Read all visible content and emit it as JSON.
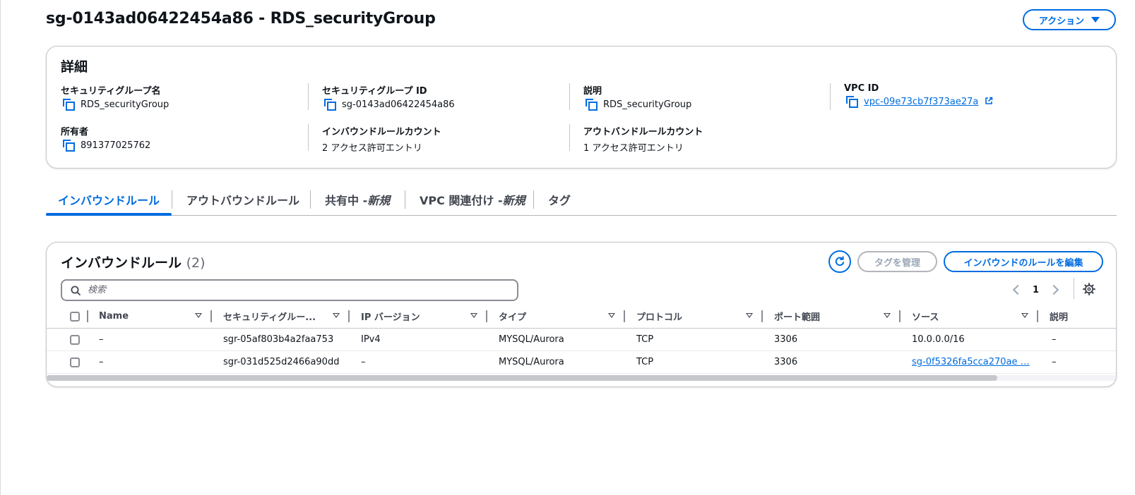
{
  "header": {
    "title": "sg-0143ad06422454a86 - RDS_securityGroup",
    "actions_label": "アクション"
  },
  "details": {
    "heading": "詳細",
    "fields": {
      "name": {
        "label": "セキュリティグループ名",
        "value": "RDS_securityGroup"
      },
      "id": {
        "label": "セキュリティグループ ID",
        "value": "sg-0143ad06422454a86"
      },
      "description": {
        "label": "説明",
        "value": "RDS_securityGroup"
      },
      "vpc": {
        "label": "VPC ID",
        "value": "vpc-09e73cb7f373ae27a"
      },
      "owner": {
        "label": "所有者",
        "value": "891377025762"
      },
      "inbound_count": {
        "label": "インバウンドルールカウント",
        "value": "2 アクセス許可エントリ"
      },
      "outbound_count": {
        "label": "アウトバンドルールカウント",
        "value": "1 アクセス許可エントリ"
      }
    }
  },
  "tabs": [
    {
      "label": "インバウンドルール",
      "suffix": "",
      "active": true
    },
    {
      "label": "アウトバウンドルール",
      "suffix": "",
      "active": false
    },
    {
      "label": "共有中 - ",
      "suffix": "新規",
      "active": false
    },
    {
      "label": "VPC 関連付け - ",
      "suffix": "新規",
      "active": false
    },
    {
      "label": "タグ",
      "suffix": "",
      "active": false
    }
  ],
  "inbound": {
    "heading": "インバウンドルール",
    "count": "(2)",
    "manage_tags_label": "タグを管理",
    "edit_label": "インバウンドのルールを編集",
    "search_placeholder": "検索",
    "page": "1",
    "columns": [
      "Name",
      "セキュリティグルー...",
      "IP バージョン",
      "タイプ",
      "プロトコル",
      "ポート範囲",
      "ソース",
      "説明"
    ],
    "rows": [
      {
        "name": "–",
        "rule_id": "sgr-05af803b4a2faa753",
        "ip_version": "IPv4",
        "type": "MYSQL/Aurora",
        "protocol": "TCP",
        "port": "3306",
        "source": "10.0.0.0/16",
        "description": "–"
      },
      {
        "name": "–",
        "rule_id": "sgr-031d525d2466a90dd",
        "ip_version": "–",
        "type": "MYSQL/Aurora",
        "protocol": "TCP",
        "port": "3306",
        "source": "sg-0f5326fa5cca270ae …",
        "description": "–"
      }
    ]
  },
  "colors": {
    "accent": "#006ce0",
    "text": "#0f141a",
    "border": "#c6c6cd",
    "disabled": "#9ba7b6"
  }
}
